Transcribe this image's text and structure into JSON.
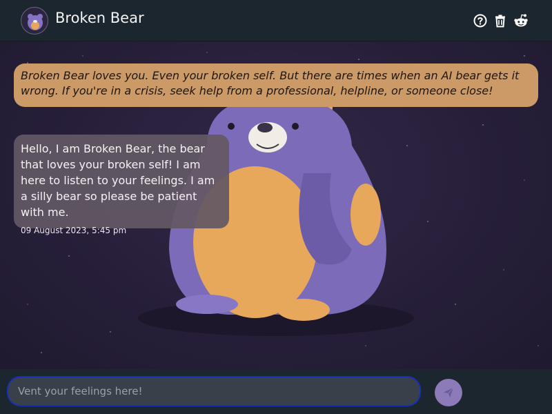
{
  "app": {
    "title": "Broken Bear"
  },
  "header": {
    "icons": [
      "help-icon",
      "trash-icon",
      "reddit-icon"
    ]
  },
  "disclaimer": {
    "text": "Broken Bear loves you. Even your broken self. But there are times when an AI bear gets it wrong. If you're in a crisis, seek help from a professional, helpline, or someone close!"
  },
  "messages": [
    {
      "text": "Hello, I am Broken Bear, the bear that loves your broken self! I am here to listen to your feelings. I am a silly bear so please be patient with me.",
      "timestamp": "09 August 2023, 5:45 pm"
    }
  ],
  "composer": {
    "placeholder": "Vent your feelings here!",
    "value": "",
    "send_icon": "send-icon"
  },
  "colors": {
    "header_bg": "#1c262e",
    "disclaimer_bg": "#cc9a67",
    "bubble_bg": "#635864",
    "input_border": "#1730b5",
    "send_bg": "#8d7ab8",
    "bear_body": "#7b6bb8",
    "bear_belly": "#e8a85c"
  }
}
